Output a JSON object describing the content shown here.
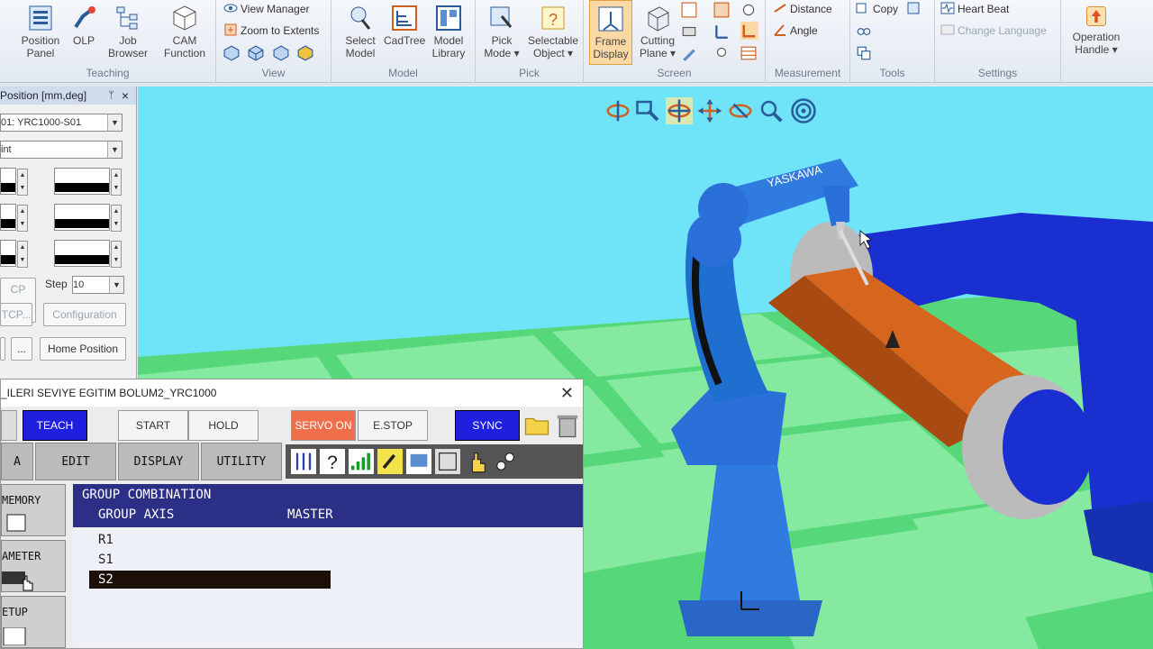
{
  "ribbon": {
    "teaching": {
      "label": "Teaching",
      "items": [
        {
          "label": "Position\nPanel",
          "icon": "position-panel-icon"
        },
        {
          "label": "OLP",
          "icon": "olp-icon"
        },
        {
          "label": "Job\nBrowser",
          "icon": "job-browser-icon"
        },
        {
          "label": "CAM\nFunction",
          "icon": "cam-function-icon"
        }
      ]
    },
    "view": {
      "label": "View",
      "view_manager": "View Manager",
      "zoom_extents": "Zoom to Extents"
    },
    "model": {
      "label": "Model",
      "items": [
        {
          "label": "Select\nModel",
          "icon": "select-model-icon"
        },
        {
          "label": "CadTree",
          "icon": "cadtree-icon"
        },
        {
          "label": "Model\nLibrary",
          "icon": "model-library-icon"
        }
      ]
    },
    "pick": {
      "label": "Pick",
      "items": [
        {
          "label": "Pick\nMode ▾",
          "icon": "pick-mode-icon"
        },
        {
          "label": "Selectable\nObject ▾",
          "icon": "selectable-object-icon"
        }
      ]
    },
    "screen": {
      "label": "Screen",
      "items": [
        {
          "label": "Frame\nDisplay",
          "icon": "frame-display-icon"
        },
        {
          "label": "Cutting\nPlane ▾",
          "icon": "cutting-plane-icon"
        }
      ]
    },
    "measurement": {
      "label": "Measurement",
      "distance": "Distance",
      "angle": "Angle"
    },
    "tools": {
      "label": "Tools",
      "copy": "Copy"
    },
    "settings": {
      "label": "Settings",
      "heart_beat": "Heart Beat",
      "change_language": "Change Language"
    },
    "operation": {
      "label": "Operation\nHandle ▾"
    }
  },
  "position_panel": {
    "title": "Position [mm,deg]",
    "controller": "01: YRC1000-S01",
    "coord": "int",
    "step_label": "Step",
    "step_value": "10",
    "tcp": "CP",
    "tcp2": "TCP...",
    "configuration": "Configuration",
    "more": "...",
    "home_position": "Home Position"
  },
  "viewport": {
    "brand": "YASKAWA"
  },
  "pendant": {
    "title": "_ILERI SEVIYE EGITIM BOLUM2_YRC1000",
    "mode": "TEACH",
    "start": "START",
    "hold": "HOLD",
    "servo": "SERVO ON",
    "estop": "E.STOP",
    "sync": "SYNC",
    "tabs": [
      "A",
      "EDIT",
      "DISPLAY",
      "UTILITY"
    ],
    "side": [
      "MEMORY",
      "AMETER",
      "ETUP"
    ],
    "screen": {
      "title": "GROUP COMBINATION",
      "col1": "GROUP AXIS",
      "col2": "MASTER",
      "rows": [
        "R1",
        "S1",
        "S2"
      ],
      "selected": "S2"
    }
  },
  "colors": {
    "accent": "#2b2f86",
    "teach": "#1f1fe0",
    "servo": "#ef6f4c",
    "robot": "#1e6fd0",
    "floor1": "#44d06a",
    "floor2": "#7fe69a",
    "sky": "#6fe3f7"
  }
}
